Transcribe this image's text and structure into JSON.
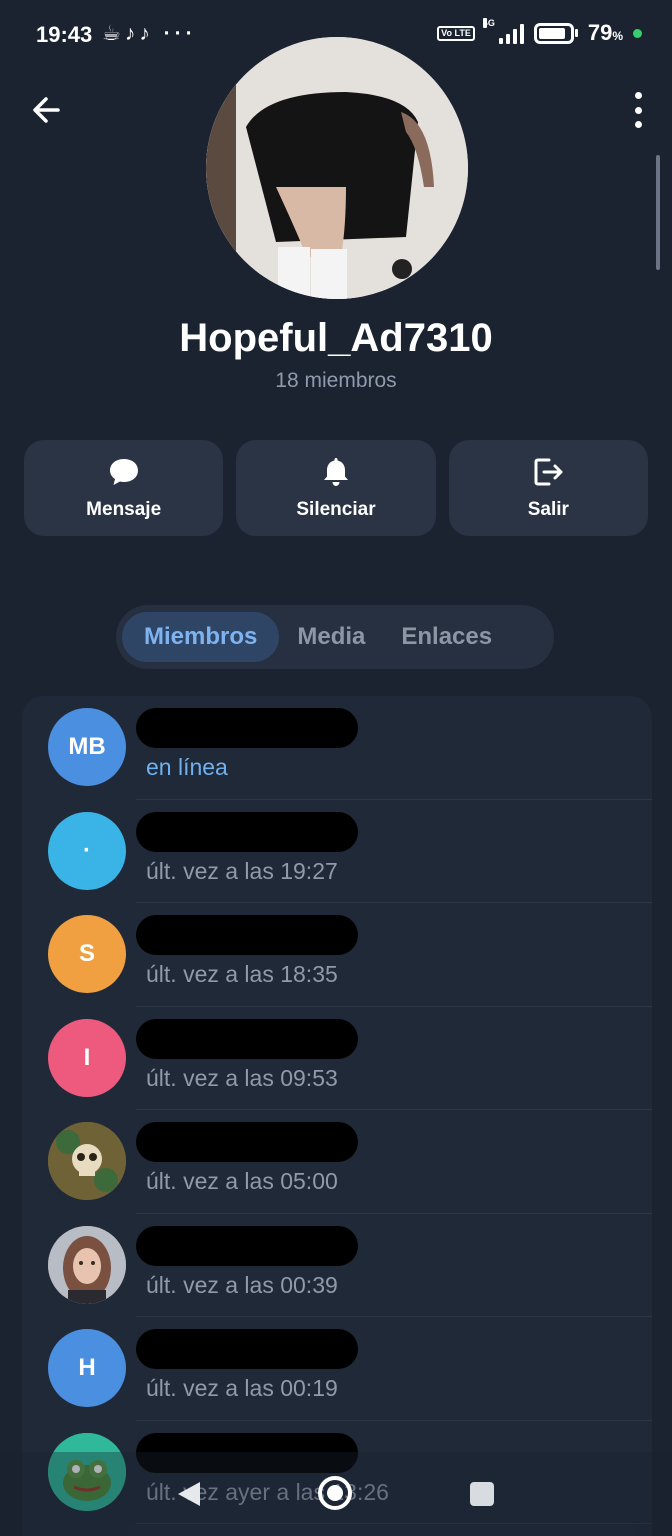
{
  "status_bar": {
    "time": "19:43",
    "notification_icons": "☕♪♪ ···",
    "network": "4G",
    "volte": "Vo LTE",
    "battery": "79",
    "battery_unit": "%"
  },
  "header": {
    "group_name": "Hopeful_Ad7310",
    "member_count": "18 miembros"
  },
  "actions": [
    {
      "label": "Mensaje",
      "icon": "chat-bubble-icon"
    },
    {
      "label": "Silenciar",
      "icon": "bell-icon"
    },
    {
      "label": "Salir",
      "icon": "logout-icon"
    }
  ],
  "tabs": [
    {
      "label": "Miembros",
      "active": true
    },
    {
      "label": "Media",
      "active": false
    },
    {
      "label": "Enlaces",
      "active": false
    }
  ],
  "members": [
    {
      "initials": "MB",
      "color": "#4a8fe0",
      "status": "en línea",
      "online": true
    },
    {
      "initials": "·",
      "color": "#3ab4e6",
      "status": "últ. vez a las 19:27",
      "online": false
    },
    {
      "initials": "S",
      "color": "#f0a040",
      "status": "últ. vez a las 18:35",
      "online": false
    },
    {
      "initials": "I",
      "color": "#ee5a7e",
      "status": "últ. vez a las 09:53",
      "online": false
    },
    {
      "initials": "",
      "color": "#7a6a3a",
      "status": "últ. vez a las 05:00",
      "online": false,
      "photo": "skull-art"
    },
    {
      "initials": "",
      "color": "#9a7a6a",
      "status": "últ. vez a las 00:39",
      "online": false,
      "photo": "woman-portrait"
    },
    {
      "initials": "H",
      "color": "#4a8fe0",
      "status": "últ. vez a las 00:19",
      "online": false
    },
    {
      "initials": "",
      "color": "#3aa890",
      "status": "últ. vez ayer a las 13:26",
      "online": false,
      "photo": "frog-sticker"
    }
  ]
}
